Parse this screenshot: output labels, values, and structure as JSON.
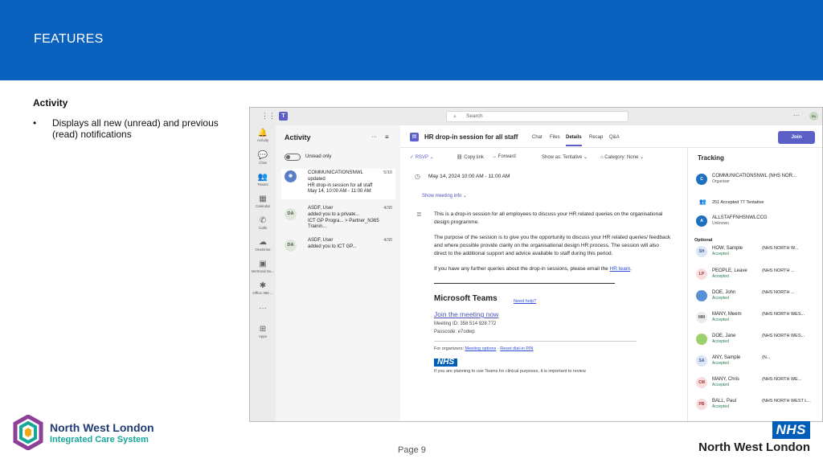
{
  "slide": {
    "title": "FEATURES",
    "heading": "Activity",
    "bullet": "Displays all new (unread) and previous (read) notifications",
    "page": "Page 9",
    "logo_left_line1": "North West London",
    "logo_left_line2": "Integrated Care System",
    "logo_right_nhs": "NHS",
    "logo_right_text": "North West London"
  },
  "teams": {
    "search_placeholder": "Search",
    "rail": [
      "Activity",
      "Chat",
      "Teams",
      "Calendar",
      "Calls",
      "OneDrive",
      "NHSmail Su...",
      "Office 365 ...",
      "Apps"
    ],
    "activity_title": "Activity",
    "unread_toggle": "Unread only",
    "activity_items": [
      {
        "avatar": "",
        "title": "COMMUNICATIONSNWL",
        "l2": "updated",
        "l3": "HR drop-in session for all staff",
        "l4": "May 14, 10:00 AM - 11:00 AM",
        "date": "5/10"
      },
      {
        "avatar": "DA",
        "title": "ASDF, User",
        "l2": "added you to a private...",
        "l3": "ICT GP Progra...  >  Partner_N365 Trainin...",
        "l4": "",
        "date": "4/30"
      },
      {
        "avatar": "DA",
        "title": "ASDF, User",
        "l2": "added you to ICT GP...",
        "l3": "",
        "l4": "",
        "date": "4/30"
      }
    ],
    "meeting_title": "HR drop-in session for all staff",
    "tabs": [
      "Chat",
      "Files",
      "Details",
      "Recap",
      "Q&A"
    ],
    "join_label": "Join",
    "toolbar": [
      "RSVP",
      "Copy link",
      "Forward",
      "Show as: Tentative",
      "Category: None"
    ],
    "datetime": "May 14, 2024 10:00 AM - 11:00 AM",
    "show_info": "Show meeting info",
    "para1": "This is a drop-in session for all employees to discuss your HR related queries on the organisational design programme.",
    "para2": "The purpose of the session is to give you the opportunity to discuss your HR related queries/ feedback and where possible provide clarity on the organisational design HR process. The session will also direct to the additional support and advice available to staff during this period.",
    "para3_pre": "If you have any further queries about the drop-in sessions, please email the ",
    "para3_link": "HR team",
    "para3_post": ".",
    "mt_heading": "Microsoft Teams",
    "need_help": "Need help?",
    "join_link": "Join the meeting now",
    "meeting_id": "Meeting ID: 358 514 928 772",
    "passcode": "Passcode: e7odwp",
    "organizers_pre": "For organizers: ",
    "meeting_options": "Meeting options",
    "reset_pin": "Reset dial-in PIN",
    "nhs_badge": "NHS",
    "clinical_note": "If you are planning to use Teams for clinical purposes, it is important to review",
    "tracking_title": "Tracking",
    "organizer": {
      "avatar": "C",
      "name": "COMMUNICATIONSNWL (NHS NOR...",
      "role": "Organiser"
    },
    "counts": "251 Accepted   77 Tentative",
    "group": {
      "avatar": "A",
      "name": "ALLSTAFFNHSNWLCCG",
      "role": "Unknown"
    },
    "optional_label": "Optional",
    "people": [
      {
        "avatar": "SH",
        "name": "HOW, Sample",
        "org": "(NHS NORTH W...",
        "status": "Accepted",
        "color": "#dce6f5",
        "fg": "#3b5b9a"
      },
      {
        "avatar": "LP",
        "name": "PEOPLE, Leave",
        "org": "(NHS NORTH ...",
        "status": "Accepted",
        "color": "#f6dede",
        "fg": "#a33"
      },
      {
        "avatar": "",
        "name": "DOE, John",
        "org": "(NHS NORTH ...",
        "status": "Accepted",
        "color": "#5b8fd6",
        "fg": "#fff"
      },
      {
        "avatar": "MM",
        "name": "MANY, Meem",
        "org": "(NHS NORTH WES...",
        "status": "Accepted",
        "color": "#ececec",
        "fg": "#555"
      },
      {
        "avatar": "",
        "name": "DOE, Jane",
        "org": "(NHS NORTH WES...",
        "status": "Accepted",
        "color": "#9ccf6d",
        "fg": "#fff"
      },
      {
        "avatar": "SA",
        "name": "ANY, Sample",
        "org": "(N...",
        "status": "Accepted",
        "color": "#dde6f3",
        "fg": "#3b5b9a"
      },
      {
        "avatar": "CM",
        "name": "MANY, Chris",
        "org": "(NHS NORTH WE...",
        "status": "Accepted",
        "color": "#f6dede",
        "fg": "#a33"
      },
      {
        "avatar": "PB",
        "name": "BALL, Paul",
        "org": "(NHS NORTH WEST L...",
        "status": "Accepted",
        "color": "#f6dede",
        "fg": "#a33"
      }
    ]
  }
}
